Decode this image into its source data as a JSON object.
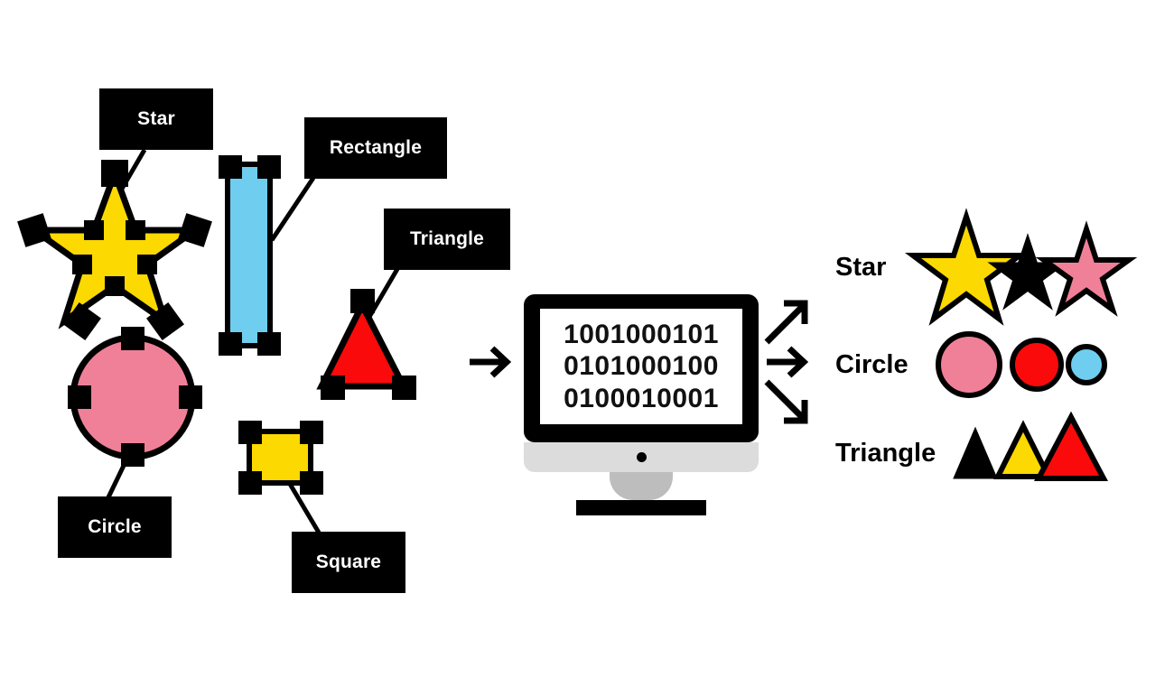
{
  "title": "Shape recognition pipeline diagram",
  "colors": {
    "yellow": "#FCD900",
    "pink": "#F08098",
    "red": "#FA0A0A",
    "blue": "#6FCDF0",
    "black": "#000000",
    "white": "#FFFFFF",
    "screen_chin": "#DCDCDC",
    "screen_neck": "#BDBDBD"
  },
  "input_shapes": [
    {
      "id": "star",
      "label": "Star",
      "fill": "#FCD900",
      "handles": 10
    },
    {
      "id": "rectangle",
      "label": "Rectangle",
      "fill": "#6FCDF0",
      "handles": 4
    },
    {
      "id": "triangle",
      "label": "Triangle",
      "fill": "#FA0A0A",
      "handles": 3
    },
    {
      "id": "circle",
      "label": "Circle",
      "fill": "#F08098",
      "handles": 4
    },
    {
      "id": "square",
      "label": "Square",
      "fill": "#FCD900",
      "handles": 4
    }
  ],
  "arrow_in": {
    "name": "arrow-right",
    "glyph": "→"
  },
  "monitor": {
    "binary_lines": [
      "1001000101",
      "0101000100",
      "0100010001"
    ]
  },
  "arrows_out": [
    {
      "name": "arrow-up-right",
      "glyph": "↗"
    },
    {
      "name": "arrow-right",
      "glyph": "→"
    },
    {
      "name": "arrow-down-right",
      "glyph": "↘"
    }
  ],
  "results": [
    {
      "label": "Star",
      "items": [
        {
          "shape": "star",
          "fill": "#FCD900",
          "size": "large",
          "px": 92
        },
        {
          "shape": "star",
          "fill": "#000000",
          "size": "small",
          "px": 50
        },
        {
          "shape": "star",
          "fill": "#F08098",
          "size": "medium",
          "px": 72
        }
      ]
    },
    {
      "label": "Circle",
      "items": [
        {
          "shape": "circle",
          "fill": "#F08098",
          "size": "large",
          "px": 66
        },
        {
          "shape": "circle",
          "fill": "#FA0A0A",
          "size": "medium",
          "px": 52
        },
        {
          "shape": "circle",
          "fill": "#6FCDF0",
          "size": "small",
          "px": 38
        }
      ]
    },
    {
      "label": "Triangle",
      "items": [
        {
          "shape": "triangle",
          "fill": "#000000",
          "size": "small",
          "px": 42
        },
        {
          "shape": "triangle",
          "fill": "#FCD900",
          "size": "medium",
          "px": 56
        },
        {
          "shape": "triangle",
          "fill": "#FA0A0A",
          "size": "large",
          "px": 72
        }
      ]
    }
  ]
}
